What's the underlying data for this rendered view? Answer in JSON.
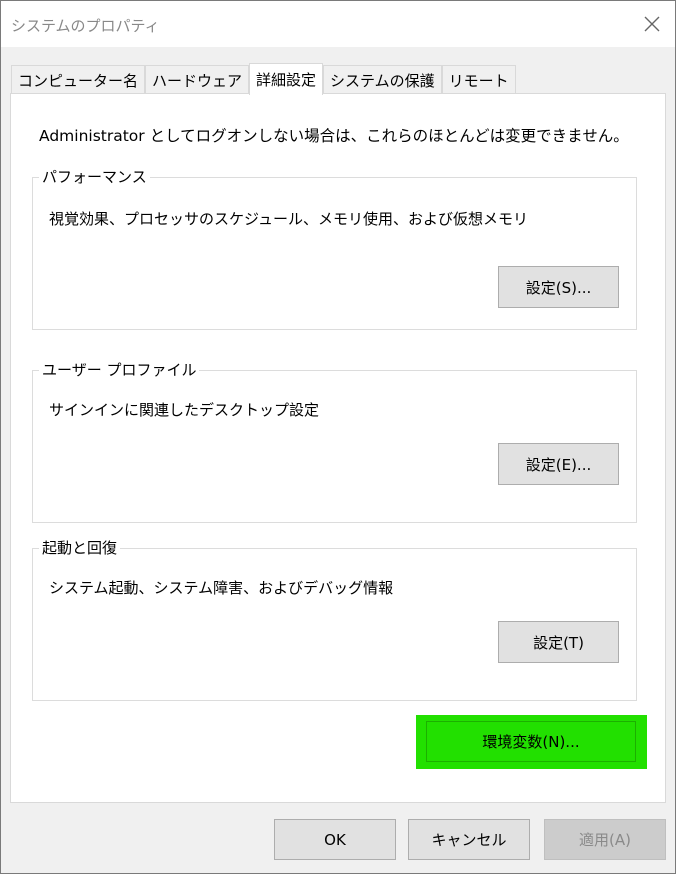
{
  "window": {
    "title": "システムのプロパティ",
    "close_icon": "close-icon"
  },
  "tabs": [
    {
      "label": "コンピューター名",
      "active": false
    },
    {
      "label": "ハードウェア",
      "active": false
    },
    {
      "label": "詳細設定",
      "active": true
    },
    {
      "label": "システムの保護",
      "active": false
    },
    {
      "label": "リモート",
      "active": false
    }
  ],
  "panel": {
    "admin_note": "Administrator としてログオンしない場合は、これらのほとんどは変更できません。",
    "performance": {
      "label": "パフォーマンス",
      "description": "視覚効果、プロセッサのスケジュール、メモリ使用、および仮想メモリ",
      "button": "設定(S)..."
    },
    "user_profile": {
      "label": "ユーザー プロファイル",
      "description": "サインインに関連したデスクトップ設定",
      "button": "設定(E)..."
    },
    "startup": {
      "label": "起動と回復",
      "description": "システム起動、システム障害、およびデバッグ情報",
      "button": "設定(T)"
    },
    "env_button": "環境変数(N)...",
    "env_highlight_color": "#22e000"
  },
  "footer": {
    "ok": "OK",
    "cancel": "キャンセル",
    "apply": "適用(A)"
  }
}
